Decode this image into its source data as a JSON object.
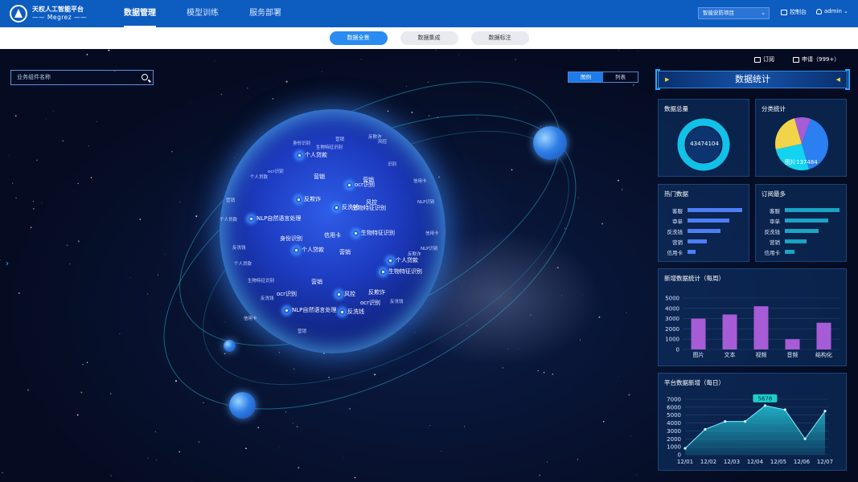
{
  "header": {
    "logo_title": "天权人工智能平台",
    "logo_subtitle": "—— Megrez ——",
    "nav": [
      "数据管理",
      "模型训练",
      "服务部署"
    ],
    "project_select": "智能安防项目",
    "console_label": "控制台",
    "user_label": "admin"
  },
  "subtabs": [
    "数据全景",
    "数据集成",
    "数据标注"
  ],
  "toolbar": {
    "search_placeholder": "业务组件名称",
    "view_toggle": [
      "图例",
      "列表"
    ],
    "subscribe_label": "订阅",
    "apply_label": "申请（999+）"
  },
  "planet": {
    "tags_main": [
      "个人贷款",
      "营销",
      "ocr识别",
      "营销",
      "反欺诈",
      "生物特征识别",
      "反洗钱",
      "风控",
      "NLP自然语言处理",
      "信用卡",
      "生物特征识别",
      "身份识别",
      "个人贷款",
      "营销",
      "个人贷款",
      "营销",
      "生物特征识别",
      "ocr识别",
      "风控",
      "反欺诈",
      "反洗钱",
      "ocr识别",
      "NLP自然语言处理"
    ],
    "tags_small": [
      "身份识别",
      "营销",
      "反欺诈",
      "生物特征识别",
      "风控",
      "ocr识别",
      "个人贷款",
      "识别",
      "信用卡",
      "营销",
      "NLP识别",
      "个人贷款",
      "反洗钱",
      "信用卡",
      "反欺诈",
      "个人贷款",
      "生物特征识别",
      "反洗钱",
      "NLP识别",
      "信用卡",
      "营销",
      "反洗钱"
    ]
  },
  "stats": {
    "title": "数据统计",
    "total": {
      "title": "数据总量",
      "value": "43474104"
    },
    "category": {
      "title": "分类统计",
      "label": "图片137484",
      "slices": [
        {
          "name": "图片",
          "value": 40,
          "color": "#2b7ff0"
        },
        {
          "name": "文本",
          "value": 26,
          "color": "#12d4f0"
        },
        {
          "name": "视频",
          "value": 24,
          "color": "#f2d44a"
        },
        {
          "name": "音频",
          "value": 10,
          "color": "#a55cd6"
        }
      ]
    },
    "hot": {
      "title": "热门数据",
      "items": [
        {
          "label": "客服",
          "value": 100
        },
        {
          "label": "审单",
          "value": 77
        },
        {
          "label": "反洗钱",
          "value": 60
        },
        {
          "label": "营销",
          "value": 36
        },
        {
          "label": "信用卡",
          "value": 15
        }
      ],
      "color": "#4e7ef5"
    },
    "subscribed": {
      "title": "订阅最多",
      "items": [
        {
          "label": "客服",
          "value": 100
        },
        {
          "label": "审单",
          "value": 80
        },
        {
          "label": "反洗钱",
          "value": 62
        },
        {
          "label": "营销",
          "value": 40
        },
        {
          "label": "信用卡",
          "value": 18
        }
      ],
      "color": "#1aa3c4"
    }
  },
  "chart_data": [
    {
      "type": "bar",
      "title": "新增数据统计（每周）",
      "categories": [
        "图片",
        "文本",
        "视频",
        "音频",
        "结构化"
      ],
      "values": [
        3000,
        3400,
        4200,
        1000,
        2600
      ],
      "ylim": [
        0,
        5000
      ],
      "yticks": [
        0,
        1000,
        2000,
        3000,
        4000,
        5000
      ],
      "color": "#a55cd6"
    },
    {
      "type": "area",
      "title": "平台数据新增（每日）",
      "x": [
        "12/01",
        "12/02",
        "12/03",
        "12/04",
        "12/05",
        "12/06",
        "12/07"
      ],
      "values": [
        800,
        3200,
        4200,
        4200,
        6200,
        5678,
        2000,
        5500
      ],
      "highlight_label": "5678",
      "ylim": [
        0,
        7000
      ],
      "yticks": [
        0,
        1000,
        2000,
        3000,
        4000,
        5000,
        6000,
        7000
      ],
      "color": "#22c6d8"
    }
  ]
}
